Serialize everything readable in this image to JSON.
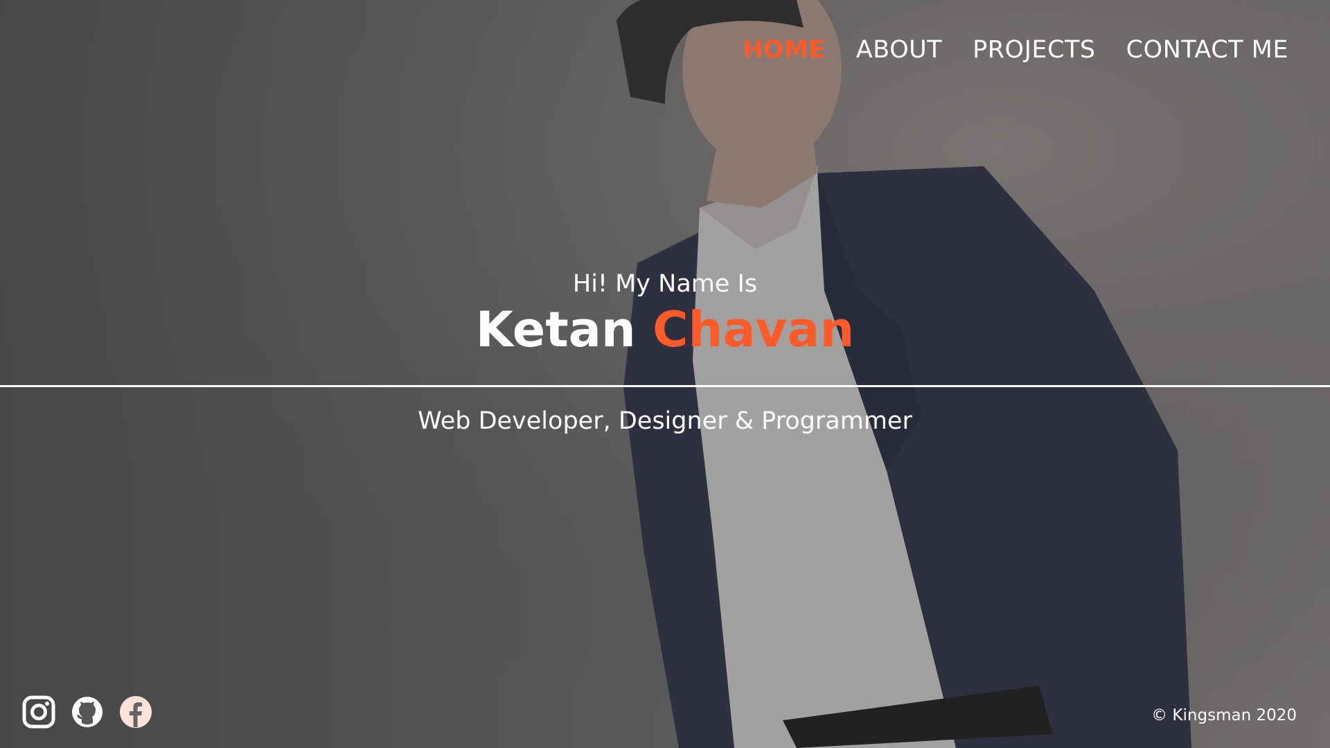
{
  "nav": {
    "items": [
      {
        "label": "HOME",
        "active": true
      },
      {
        "label": "ABOUT",
        "active": false
      },
      {
        "label": "PROJECTS",
        "active": false
      },
      {
        "label": "CONTACT ME",
        "active": false
      }
    ]
  },
  "hero": {
    "greeting": "Hi! My Name Is",
    "first_name": "Ketan",
    "last_name": "Chavan",
    "tagline": "Web Developer, Designer & Programmer"
  },
  "socials": [
    {
      "icon": "instagram-icon"
    },
    {
      "icon": "github-icon"
    },
    {
      "icon": "facebook-icon"
    }
  ],
  "footer": {
    "copyright": "© Kingsman 2020"
  },
  "colors": {
    "accent": "#ff5a2a",
    "text": "#ffffff"
  }
}
